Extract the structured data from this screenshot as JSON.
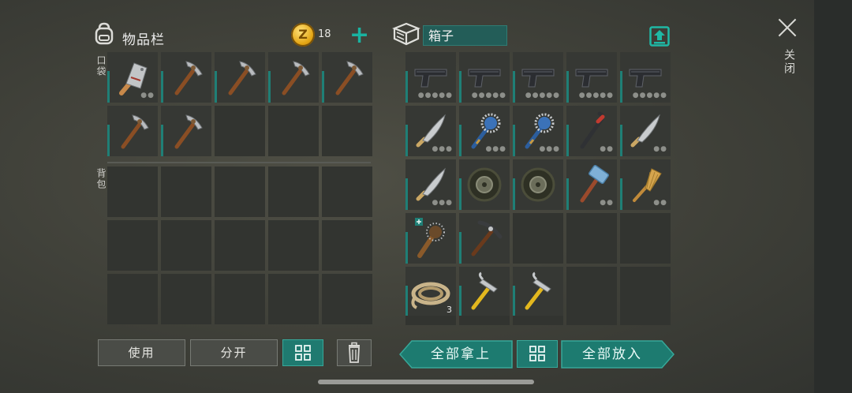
{
  "inventory": {
    "title": "物品栏",
    "coins": "18",
    "plus_label": "+",
    "pocket_label": "口袋",
    "backpack_label": "背包",
    "pocket_slots": [
      {
        "icon": "cleaver-icon",
        "bar": true,
        "dots": "●●"
      },
      {
        "icon": "pickaxe-icon",
        "bar": true,
        "dots": ""
      },
      {
        "icon": "pickaxe-icon",
        "bar": true,
        "dots": ""
      },
      {
        "icon": "pickaxe-icon",
        "bar": true,
        "dots": ""
      },
      {
        "icon": "pickaxe-icon",
        "bar": true,
        "dots": ""
      },
      {
        "icon": "pickaxe-icon",
        "bar": true,
        "dots": ""
      },
      {
        "icon": "pickaxe-icon",
        "bar": true,
        "dots": ""
      },
      {
        "icon": "",
        "bar": false,
        "dots": ""
      },
      {
        "icon": "",
        "bar": false,
        "dots": ""
      },
      {
        "icon": "",
        "bar": false,
        "dots": ""
      }
    ],
    "backpack_slot_count": 15,
    "buttons": {
      "use": "使用",
      "split": "分开"
    }
  },
  "container": {
    "name": "箱子",
    "slots": [
      {
        "icon": "pistol-icon",
        "dots": "●●●●●"
      },
      {
        "icon": "pistol-icon",
        "dots": "●●●●●"
      },
      {
        "icon": "pistol-icon",
        "dots": "●●●●●"
      },
      {
        "icon": "pistol-icon",
        "dots": "●●●●●"
      },
      {
        "icon": "pistol-icon",
        "dots": "●●●●●"
      },
      {
        "icon": "machete-icon",
        "dots": "●●●"
      },
      {
        "icon": "spiked-mace-icon",
        "dots": "●●●"
      },
      {
        "icon": "spiked-mace-icon",
        "dots": "●●●"
      },
      {
        "icon": "crowbar-icon",
        "dots": "●●"
      },
      {
        "icon": "machete-icon",
        "dots": "●●"
      },
      {
        "icon": "machete-icon",
        "dots": "●●●"
      },
      {
        "icon": "tire-icon",
        "dots": ""
      },
      {
        "icon": "tire-icon",
        "dots": ""
      },
      {
        "icon": "sledgehammer-icon",
        "dots": "●●"
      },
      {
        "icon": "broom-icon",
        "dots": "●●"
      },
      {
        "icon": "spiked-club-icon",
        "dots": ""
      },
      {
        "icon": "iron-pickaxe-icon",
        "dots": ""
      },
      {
        "icon": "",
        "dots": ""
      },
      {
        "icon": "",
        "dots": ""
      },
      {
        "icon": "",
        "dots": ""
      },
      {
        "icon": "rope-icon",
        "dots": "",
        "count": "3"
      },
      {
        "icon": "hammer-icon",
        "dots": ""
      },
      {
        "icon": "hammer-icon",
        "dots": ""
      },
      {
        "icon": "",
        "dots": ""
      },
      {
        "icon": "",
        "dots": ""
      }
    ],
    "buttons": {
      "take_all": "全部拿上",
      "put_all": "全部放入"
    }
  },
  "close_label": "关闭",
  "colors": {
    "accent": "#1f7a70",
    "bar": "#1f7f76",
    "background": "#3e3f38"
  }
}
